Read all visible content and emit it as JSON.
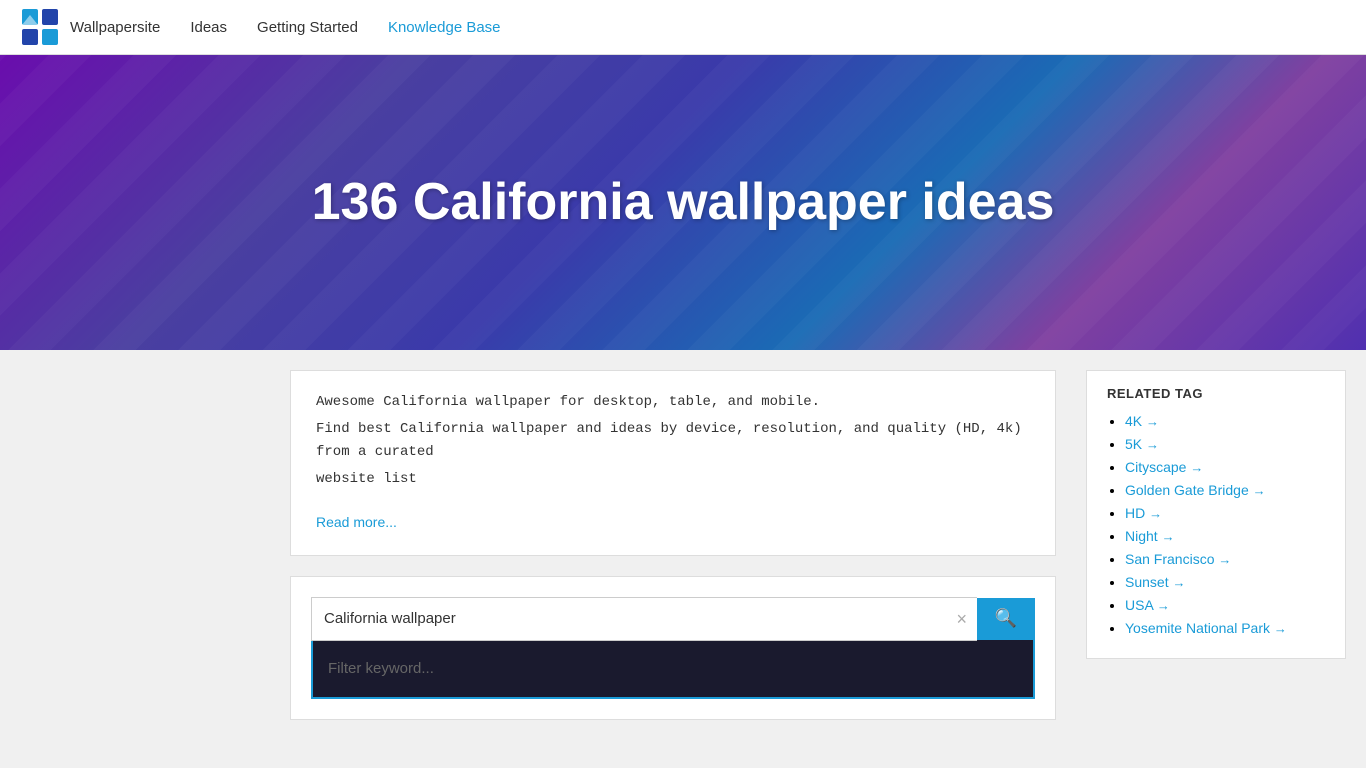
{
  "nav": {
    "logo_alt": "Wallpaper Site Logo",
    "links": [
      {
        "label": "Wallpapersite",
        "href": "#",
        "active": false
      },
      {
        "label": "Ideas",
        "href": "#",
        "active": false
      },
      {
        "label": "Getting Started",
        "href": "#",
        "active": false
      },
      {
        "label": "Knowledge Base",
        "href": "#",
        "active": true
      }
    ]
  },
  "hero": {
    "title": "136 California wallpaper ideas"
  },
  "description": {
    "line1": "Awesome California wallpaper for desktop, table, and mobile.",
    "line2": "Find best California wallpaper and ideas by device, resolution, and quality (HD, 4k) from a curated",
    "line3": "website list",
    "read_more_label": "Read more..."
  },
  "search": {
    "value": "California wallpaper",
    "placeholder": "California wallpaper",
    "clear_label": "×",
    "button_icon": "🔍"
  },
  "filter": {
    "placeholder": "Filter keyword..."
  },
  "related_tags": {
    "title": "RELATED TAG",
    "items": [
      {
        "label": "4K",
        "href": "#"
      },
      {
        "label": "5K",
        "href": "#"
      },
      {
        "label": "Cityscape",
        "href": "#"
      },
      {
        "label": "Golden Gate Bridge",
        "href": "#"
      },
      {
        "label": "HD",
        "href": "#"
      },
      {
        "label": "Night",
        "href": "#"
      },
      {
        "label": "San Francisco",
        "href": "#"
      },
      {
        "label": "Sunset",
        "href": "#"
      },
      {
        "label": "USA",
        "href": "#"
      },
      {
        "label": "Yosemite National Park",
        "href": "#"
      }
    ]
  }
}
